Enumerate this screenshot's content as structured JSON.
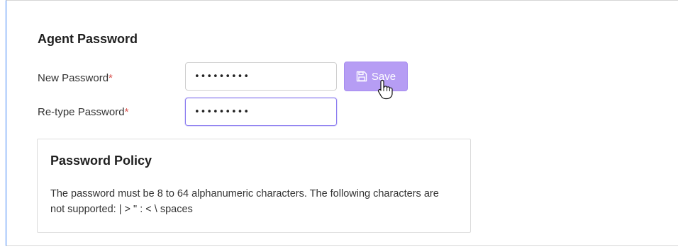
{
  "section": {
    "title": "Agent Password"
  },
  "form": {
    "new_password": {
      "label": "New Password",
      "required_mark": "*",
      "value": "•••••••••"
    },
    "retype_password": {
      "label": "Re-type Password",
      "required_mark": "*",
      "value": "•••••••••"
    },
    "save_button": {
      "label": "Save",
      "icon": "floppy-disk-icon"
    }
  },
  "policy": {
    "title": "Password Policy",
    "text": "The password must be 8 to 64 alphanumeric characters. The following characters are not supported: | > \" : < \\ spaces"
  },
  "colors": {
    "accent": "#b69df4",
    "focus_border": "#8b7cf0",
    "required": "#d9534f",
    "left_border": "#3b82f6"
  }
}
